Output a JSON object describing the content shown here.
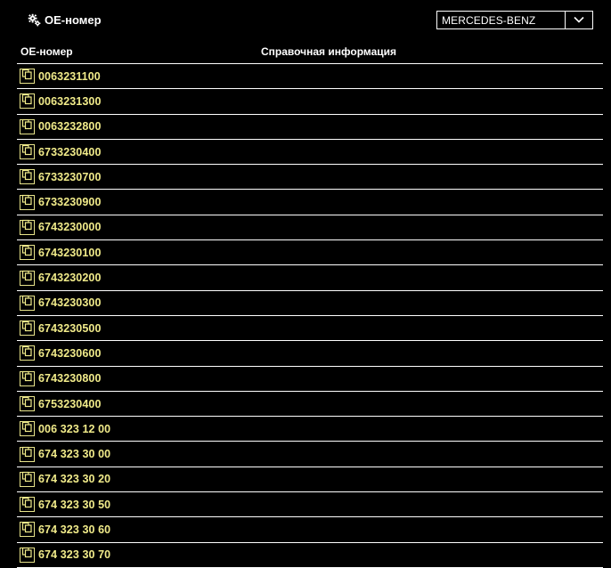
{
  "header": {
    "title": "OE-номер",
    "title_icon": "gear-icon",
    "brand_select": {
      "value": "MERCEDES-BENZ",
      "icon": "chevron-down-icon"
    }
  },
  "table": {
    "columns": [
      "OE-номер",
      "Справочная информация"
    ],
    "rows": [
      {
        "oe": "0063231100",
        "info": ""
      },
      {
        "oe": "0063231300",
        "info": ""
      },
      {
        "oe": "0063232800",
        "info": ""
      },
      {
        "oe": "6733230400",
        "info": ""
      },
      {
        "oe": "6733230700",
        "info": ""
      },
      {
        "oe": "6733230900",
        "info": ""
      },
      {
        "oe": "6743230000",
        "info": ""
      },
      {
        "oe": "6743230100",
        "info": ""
      },
      {
        "oe": "6743230200",
        "info": ""
      },
      {
        "oe": "6743230300",
        "info": ""
      },
      {
        "oe": "6743230500",
        "info": ""
      },
      {
        "oe": "6743230600",
        "info": ""
      },
      {
        "oe": "6743230800",
        "info": ""
      },
      {
        "oe": "6753230400",
        "info": ""
      },
      {
        "oe": "006 323 12 00",
        "info": ""
      },
      {
        "oe": "674 323 30 00",
        "info": ""
      },
      {
        "oe": "674 323 30 20",
        "info": ""
      },
      {
        "oe": "674 323 30 50",
        "info": ""
      },
      {
        "oe": "674 323 30 60",
        "info": ""
      },
      {
        "oe": "674 323 30 70",
        "info": ""
      }
    ],
    "row_icon": "copy-icon"
  },
  "colors": {
    "background": "#000000",
    "text": "#ffffff",
    "accent": "#f1eb8a",
    "border": "#ffffff"
  }
}
